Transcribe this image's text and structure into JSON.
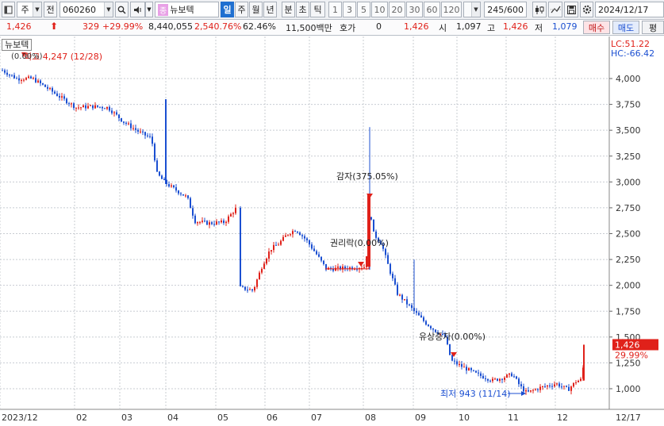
{
  "toolbar": {
    "market": "주",
    "prev": "전",
    "code": "060260",
    "badge": "종",
    "name": "뉴보텍",
    "periods": [
      "일",
      "주",
      "월",
      "년",
      "분",
      "초",
      "틱"
    ],
    "active_period": "일",
    "numbers": [
      "1",
      "3",
      "5",
      "10",
      "20",
      "30",
      "60",
      "120"
    ],
    "count": "245/600",
    "date": "2024/12/17"
  },
  "info": {
    "price": "1,426",
    "change": "329",
    "change_pct": "+29.99%",
    "volume": "8,440,055",
    "volume_pct": "2,540.76%",
    "turnover": "62.46%",
    "amount": "11,500백만",
    "quote_label": "호가",
    "quote_value": "0",
    "quote_price": "1,426",
    "open_label": "시",
    "open": "1,097",
    "high_label": "고",
    "high": "1,426",
    "low_label": "저",
    "low": "1,079",
    "buy": "매수",
    "sell": "매도",
    "eval": "평"
  },
  "legend": {
    "stock": "뉴보텍",
    "pct_tag": "(0.00%)",
    "lc": "LC:51.22",
    "hc": "HC:-66.42"
  },
  "annotations": {
    "high": "최고 4,247 (12/28)",
    "low": "최저 943 (11/14)",
    "reduction": "감자(375.05%)",
    "rights": "권리락(0.00%)",
    "offering": "유상증자(0.00%)",
    "current_price": "1,426",
    "current_pct": "29.99%"
  },
  "colors": {
    "up": "#e0211a",
    "down": "#1b4fd1",
    "grid": "#c8ccd2"
  },
  "chart_data": {
    "type": "candlestick",
    "y_ticks": [
      "4,000",
      "3,750",
      "3,500",
      "3,250",
      "3,000",
      "2,750",
      "2,500",
      "2,250",
      "2,000",
      "1,750",
      "1,500",
      "1,250",
      "1,000"
    ],
    "x_ticks": [
      "2023/12",
      "02",
      "03",
      "04",
      "05",
      "06",
      "07",
      "08",
      "09",
      "10",
      "11",
      "12",
      "12/17"
    ],
    "ylim": [
      870,
      4320
    ],
    "series": [
      {
        "x": "2023/12",
        "y": 4050
      },
      {
        "x": "01",
        "y": 3900
      },
      {
        "x": "02",
        "y": 3720
      },
      {
        "x": "03",
        "y": 3480
      },
      {
        "x": "04",
        "y": 2950
      },
      {
        "x": "05",
        "y": 2590
      },
      {
        "x": "06",
        "y": 2300
      },
      {
        "x": "07",
        "y": 2100
      },
      {
        "x": "08",
        "y": 2500
      },
      {
        "x": "09",
        "y": 1610
      },
      {
        "x": "10",
        "y": 1180
      },
      {
        "x": "11",
        "y": 1010
      },
      {
        "x": "12/17",
        "y": 1426
      }
    ]
  }
}
